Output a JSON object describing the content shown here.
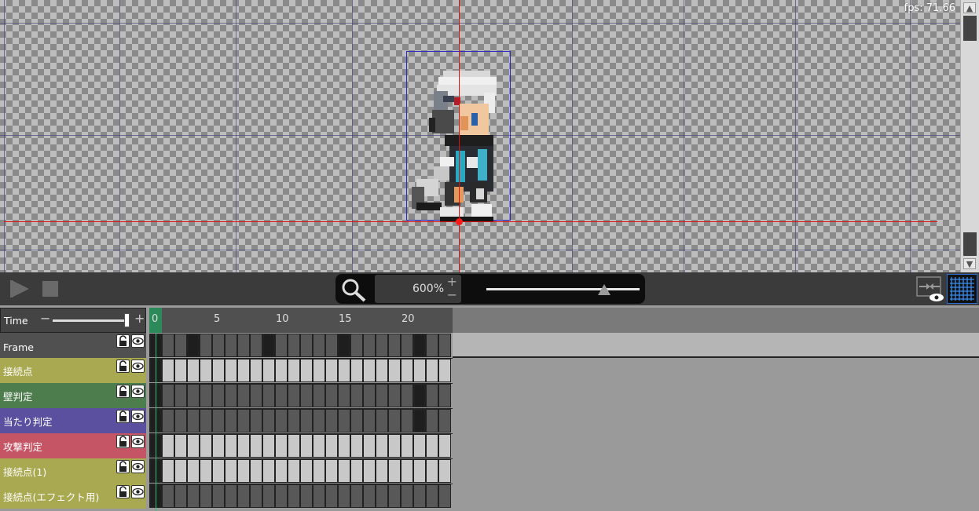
{
  "canvas": {
    "fps_text": "fps: 71.66"
  },
  "toolbar": {
    "play_icon": "play-icon",
    "stop_icon": "stop-icon",
    "zoom_icon": "magnifier-icon",
    "zoom_value": "600%",
    "zoom_plus": "+",
    "zoom_minus": "−",
    "zoom_slider_level": 0.77,
    "onion_icon": "onion-skin-icon",
    "grid_icon": "grid-icon"
  },
  "timeline": {
    "time_label": "Time",
    "time_minus": "−",
    "time_plus": "+",
    "time_slider_level": 0.96,
    "ruler": {
      "current": "0",
      "ticks": [
        "5",
        "10",
        "15",
        "20"
      ]
    },
    "frame_count": 24,
    "tracks": [
      {
        "label": "Frame",
        "color": "#505050",
        "keyframes": [
          0,
          3,
          9,
          15,
          21
        ],
        "light": false
      },
      {
        "label": "接続点",
        "color": "#a9a951",
        "keyframes": [
          0
        ],
        "light": true
      },
      {
        "label": "壁判定",
        "color": "#4d7d4d",
        "keyframes": [
          0,
          21
        ],
        "light": false
      },
      {
        "label": "当たり判定",
        "color": "#5b4fa0",
        "keyframes": [
          0,
          21
        ],
        "light": false
      },
      {
        "label": "攻撃判定",
        "color": "#c55565",
        "keyframes": [
          0
        ],
        "light": true
      },
      {
        "label": "接続点(1)",
        "color": "#a9a951",
        "keyframes": [
          0
        ],
        "light": true
      },
      {
        "label": "接続点(エフェクト用)",
        "color": "#a9a951",
        "keyframes": [
          0
        ],
        "light": false
      }
    ]
  }
}
